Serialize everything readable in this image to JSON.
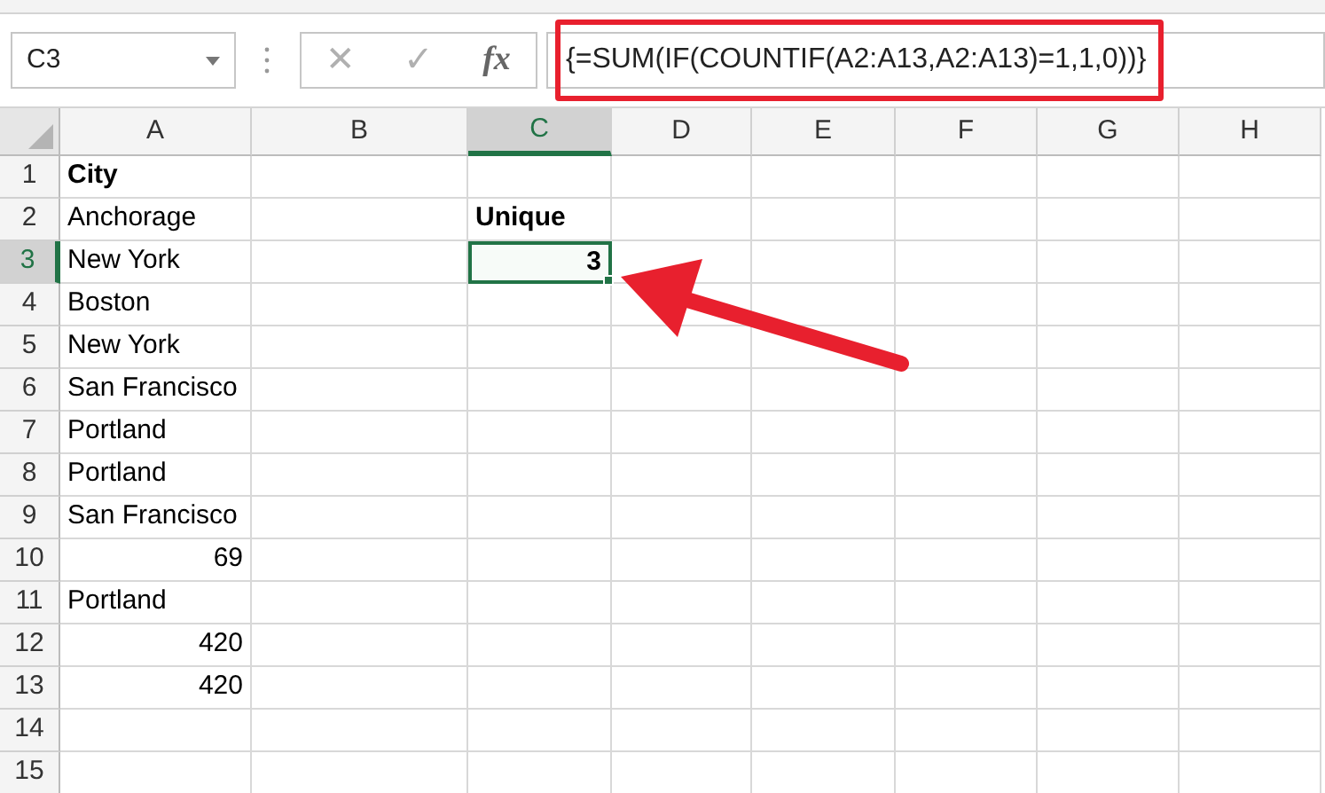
{
  "name_box": {
    "value": "C3"
  },
  "formula_bar": {
    "cancel": "✕",
    "enter": "✓",
    "function": "fx",
    "formula": "{=SUM(IF(COUNTIF(A2:A13,A2:A13)=1,1,0))}"
  },
  "columns": [
    {
      "label": "A",
      "selected": false
    },
    {
      "label": "B",
      "selected": false
    },
    {
      "label": "C",
      "selected": true
    },
    {
      "label": "D",
      "selected": false
    },
    {
      "label": "E",
      "selected": false
    },
    {
      "label": "F",
      "selected": false
    },
    {
      "label": "G",
      "selected": false
    },
    {
      "label": "H",
      "selected": false
    }
  ],
  "rows": [
    {
      "label": "1",
      "selected": false,
      "cells": {
        "A": {
          "text": "City",
          "bold": true,
          "kind": "text",
          "selected": false
        }
      }
    },
    {
      "label": "2",
      "selected": false,
      "cells": {
        "A": {
          "text": "Anchorage",
          "bold": false,
          "kind": "text",
          "selected": false
        },
        "C": {
          "text": "Unique",
          "bold": true,
          "kind": "text",
          "selected": false
        }
      }
    },
    {
      "label": "3",
      "selected": true,
      "cells": {
        "A": {
          "text": "New York",
          "bold": false,
          "kind": "text",
          "selected": false
        },
        "C": {
          "text": "3",
          "bold": true,
          "kind": "number",
          "selected": true
        }
      }
    },
    {
      "label": "4",
      "selected": false,
      "cells": {
        "A": {
          "text": "Boston",
          "bold": false,
          "kind": "text",
          "selected": false
        }
      }
    },
    {
      "label": "5",
      "selected": false,
      "cells": {
        "A": {
          "text": "New York",
          "bold": false,
          "kind": "text",
          "selected": false
        }
      }
    },
    {
      "label": "6",
      "selected": false,
      "cells": {
        "A": {
          "text": "San Francisco",
          "bold": false,
          "kind": "text",
          "selected": false
        }
      }
    },
    {
      "label": "7",
      "selected": false,
      "cells": {
        "A": {
          "text": "Portland",
          "bold": false,
          "kind": "text",
          "selected": false
        }
      }
    },
    {
      "label": "8",
      "selected": false,
      "cells": {
        "A": {
          "text": "Portland",
          "bold": false,
          "kind": "text",
          "selected": false
        }
      }
    },
    {
      "label": "9",
      "selected": false,
      "cells": {
        "A": {
          "text": "San Francisco",
          "bold": false,
          "kind": "text",
          "selected": false
        }
      }
    },
    {
      "label": "10",
      "selected": false,
      "cells": {
        "A": {
          "text": "69",
          "bold": false,
          "kind": "number",
          "selected": false
        }
      }
    },
    {
      "label": "11",
      "selected": false,
      "cells": {
        "A": {
          "text": "Portland",
          "bold": false,
          "kind": "text",
          "selected": false
        }
      }
    },
    {
      "label": "12",
      "selected": false,
      "cells": {
        "A": {
          "text": "420",
          "bold": false,
          "kind": "number",
          "selected": false
        }
      }
    },
    {
      "label": "13",
      "selected": false,
      "cells": {
        "A": {
          "text": "420",
          "bold": false,
          "kind": "number",
          "selected": false
        }
      }
    },
    {
      "label": "14",
      "selected": false
    },
    {
      "label": "15",
      "selected": false
    }
  ]
}
